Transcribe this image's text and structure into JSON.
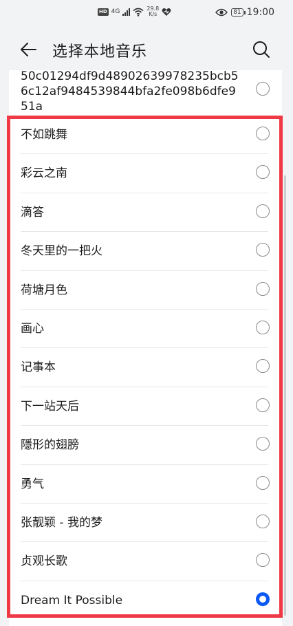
{
  "status_bar": {
    "hd": "HD",
    "network": "4G",
    "speed_value": "29.8",
    "speed_unit": "K/s",
    "battery": "81",
    "time": "19:00"
  },
  "header": {
    "back_icon": "arrow-left-icon",
    "title": "选择本地音乐",
    "search_icon": "search-icon"
  },
  "list": {
    "partial_item": {
      "label": "50c01294df9d48902639978235bcb56c12af9484539844bfa2fe098b6dfe951a",
      "selected": false
    },
    "items": [
      {
        "label": "不如跳舞",
        "selected": false
      },
      {
        "label": "彩云之南",
        "selected": false
      },
      {
        "label": "滴答",
        "selected": false
      },
      {
        "label": "冬天里的一把火",
        "selected": false
      },
      {
        "label": "荷塘月色",
        "selected": false
      },
      {
        "label": "画心",
        "selected": false
      },
      {
        "label": "记事本",
        "selected": false
      },
      {
        "label": "下一站天后",
        "selected": false
      },
      {
        "label": "隱形的翅膀",
        "selected": false
      },
      {
        "label": "勇气",
        "selected": false
      },
      {
        "label": "张靓颖 - 我的梦",
        "selected": false
      },
      {
        "label": "贞观长歌",
        "selected": false
      },
      {
        "label": "Dream It Possible",
        "selected": true
      }
    ]
  },
  "colors": {
    "accent": "#0a59f7",
    "highlight": "#ef3a45",
    "background": "#f1f3f5"
  }
}
